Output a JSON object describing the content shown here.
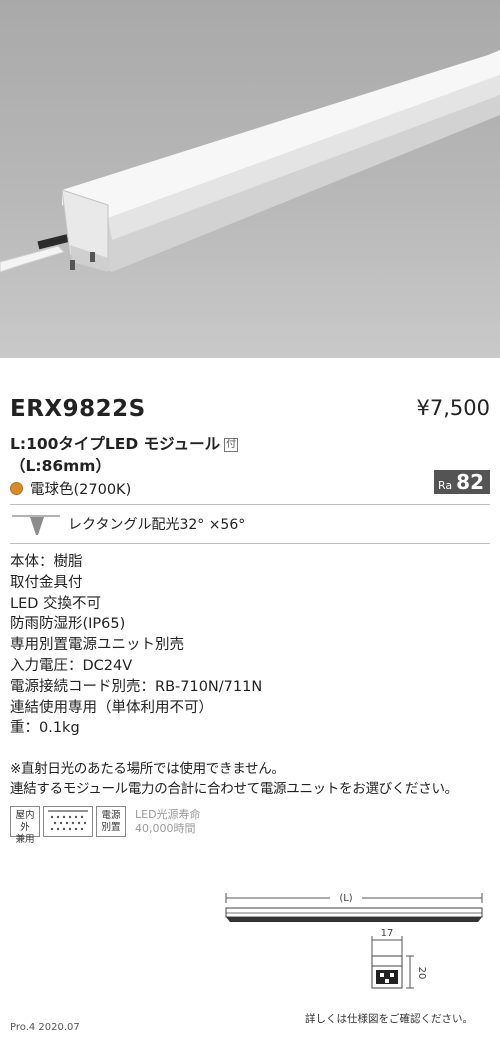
{
  "product": {
    "model": "ERX9822S",
    "price": "¥7,500",
    "subtitle": "L:100タイプLED モジュール",
    "tsuki_label": "付",
    "length": "（L:86mm）",
    "color_temp": "電球色(2700K)",
    "ra_label": "Ra",
    "ra_value": "82",
    "beam": "レクタングル配光32°  ×56°"
  },
  "specs": [
    "本体：樹脂",
    "取付金具付",
    "LED 交換不可",
    "防雨防湿形(IP65)",
    "専用別置電源ユニット別売",
    "入力電圧：DC24V",
    "電源接続コード別売：RB-710N/711N",
    "連結使用専用（単体利用不可）",
    "重：0.1kg"
  ],
  "notes": [
    "※直射日光のあたる場所では使用できません。",
    "連結するモジュール電力の合計に合わせて電源ユニットをお選びください。"
  ],
  "icons": {
    "indoor_outdoor": [
      "屋内外",
      "兼用"
    ],
    "power_separate": [
      "電源",
      "別置"
    ],
    "led_life": [
      "LED光源寿命",
      "40,000時間"
    ]
  },
  "drawing": {
    "length_label": "(L)",
    "width_label": "17",
    "height_label": "20"
  },
  "detail_note": "詳しくは仕様図をご確認ください。",
  "footer": "Pro.4 2020.07",
  "colors": {
    "color_dot": "#d98b2b",
    "ra_badge": "#545454"
  }
}
